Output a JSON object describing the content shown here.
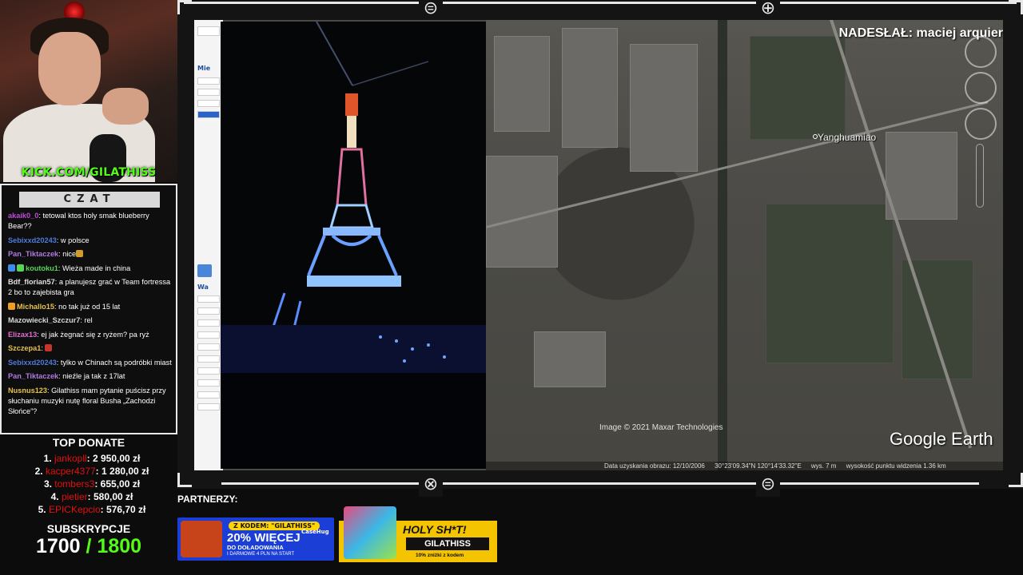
{
  "stream": {
    "kick_link": "KICK.COM/GILATHISS"
  },
  "chat": {
    "title": "CZAT",
    "messages": [
      {
        "user": "akaik0_0",
        "color": "#c04bd6",
        "text": "tetowal ktos holy smak blueberry Bear??"
      },
      {
        "user": "Sebixxd20243",
        "color": "#4f7bdc",
        "text": "w polsce"
      },
      {
        "user": "Pan_Tiktaczek",
        "color": "#b07be0",
        "text": "nice",
        "emote": "#d39a2a"
      },
      {
        "user": "koutoku1",
        "color": "#58d558",
        "text": "Wieża made in china",
        "badges": [
          "#3d8df0",
          "#58d558"
        ]
      },
      {
        "user": "Bdf_florian57",
        "color": "#e0e0e0",
        "text": "a planujesz grać w Team fortressa 2 bo to zajebista gra"
      },
      {
        "user": "Michallo15",
        "color": "#e6c24a",
        "text": "no tak już od 15 lat",
        "badges": [
          "#f0a020"
        ]
      },
      {
        "user": "Mazowiecki_Szczur7",
        "color": "#d8d8d8",
        "text": "rel"
      },
      {
        "user": "Elizax13",
        "color": "#e26bd2",
        "text": "ej jak żegnać się z ryżem? pa ryż"
      },
      {
        "user": "Szczepa1",
        "color": "#e6c24a",
        "text": "",
        "emote": "#c6342c"
      },
      {
        "user": "Sebixxd20243",
        "color": "#4f7bdc",
        "text": "tylko w Chinach są podróbki miast"
      },
      {
        "user": "Pan_Tiktaczek",
        "color": "#b07be0",
        "text": "nieźle ja tak z 17lat"
      },
      {
        "user": "Nusnus123",
        "color": "#e6c24a",
        "text": "Gilathiss mam pytanie puścisz przy słuchaniu muzyki nutę floral Busha „Zachodzi Słońce”?"
      }
    ]
  },
  "top_donate": {
    "title": "TOP DONATE",
    "entries": [
      {
        "rank": "1.",
        "name": "jankopll",
        "amount": "2 950,00 zł"
      },
      {
        "rank": "2.",
        "name": "kacper4377",
        "amount": "1 280,00 zł"
      },
      {
        "rank": "3.",
        "name": "tombers3",
        "amount": "655,00 zł"
      },
      {
        "rank": "4.",
        "name": "pietier",
        "amount": "580,00 zł"
      },
      {
        "rank": "5.",
        "name": "EPICKepcio",
        "amount": "576,70 zł"
      }
    ]
  },
  "subs": {
    "title": "SUBSKRYPCJE",
    "current": "1700",
    "goal": "/ 1800"
  },
  "screen": {
    "submitter": "NADESŁAŁ: maciej arquier",
    "place_label": "Yanghuamiao",
    "copyright": "Image © 2021 Maxar Technologies",
    "logo": "Google Earth",
    "status": {
      "date": "Data uzyskania obrazu: 12/10/2006",
      "coords": "30°23'09.34\"N   120°14'33.32\"E",
      "elev": "wys.    7 m",
      "eye": "wysokość punktu widzenia   1.36 km"
    },
    "ge_panel_labels": [
      "Mie",
      "Wa"
    ]
  },
  "partners": {
    "label": "PARTNERZY:",
    "ad1": {
      "badge": "Z KODEM: \"GILATHISS\"",
      "brand": "CaseHug",
      "headline": "20% WIĘCEJ",
      "subline": "DO DOŁADOWANIA",
      "small": "I DARMOWE 4 PLN NA START"
    },
    "ad2": {
      "headline": "HOLY SH*T!",
      "code": "GILATHISS",
      "small": "10% zniżki z kodem"
    }
  },
  "colors": {
    "kick_green": "#53fc18",
    "donor_red": "#e01010",
    "frame": "#e8e8e8"
  }
}
